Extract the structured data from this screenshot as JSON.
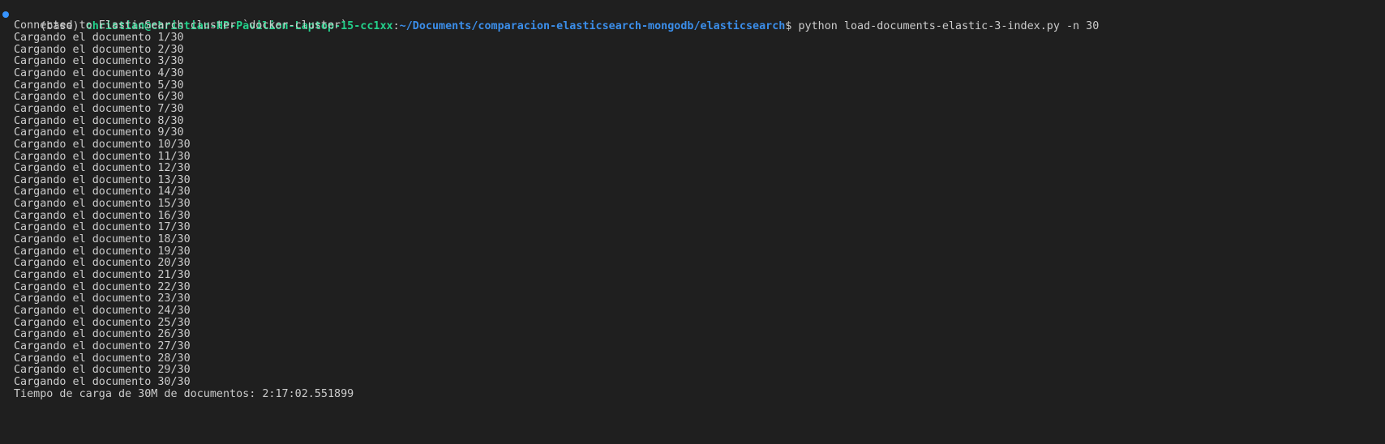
{
  "colors": {
    "background": "#1f1f1f",
    "text": "#cccccc",
    "user_host": "#23d18b",
    "path": "#3b8eea",
    "prompt_dot": "#3794ff"
  },
  "prompt": {
    "env": "(base) ",
    "user_host": "christian@christian-HP-Pavilion-Laptop-15-cc1xx",
    "separator": ":",
    "path": "~/Documents/comparacion-elasticsearch-mongodb/elasticsearch",
    "symbol": "$ ",
    "command": "python load-documents-elastic-3-index.py -n 30"
  },
  "output": {
    "connected": "Connected to ElasticSearch cluster `docker-cluster`",
    "lines": [
      "Cargando el documento 1/30",
      "Cargando el documento 2/30",
      "Cargando el documento 3/30",
      "Cargando el documento 4/30",
      "Cargando el documento 5/30",
      "Cargando el documento 6/30",
      "Cargando el documento 7/30",
      "Cargando el documento 8/30",
      "Cargando el documento 9/30",
      "Cargando el documento 10/30",
      "Cargando el documento 11/30",
      "Cargando el documento 12/30",
      "Cargando el documento 13/30",
      "Cargando el documento 14/30",
      "Cargando el documento 15/30",
      "Cargando el documento 16/30",
      "Cargando el documento 17/30",
      "Cargando el documento 18/30",
      "Cargando el documento 19/30",
      "Cargando el documento 20/30",
      "Cargando el documento 21/30",
      "Cargando el documento 22/30",
      "Cargando el documento 23/30",
      "Cargando el documento 24/30",
      "Cargando el documento 25/30",
      "Cargando el documento 26/30",
      "Cargando el documento 27/30",
      "Cargando el documento 28/30",
      "Cargando el documento 29/30",
      "Cargando el documento 30/30"
    ],
    "final": "Tiempo de carga de 30M de documentos: 2:17:02.551899"
  }
}
